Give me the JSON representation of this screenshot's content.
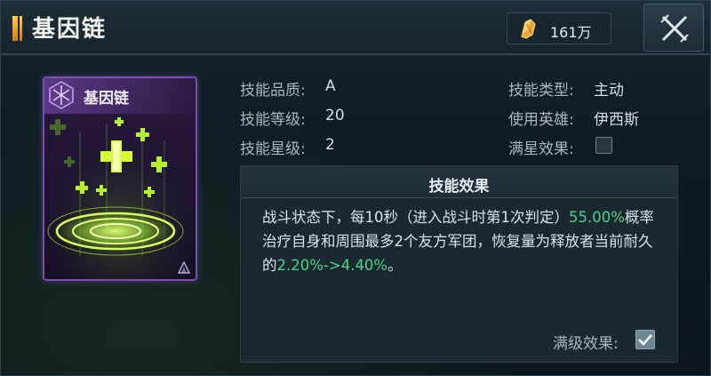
{
  "header": {
    "title": "基因链",
    "currency_amount": "161万",
    "icons": {
      "currency": "gold-crystal-icon",
      "close": "close-x-icon"
    }
  },
  "card": {
    "name": "基因链",
    "icons": {
      "badge": "hexagon-emblem-icon",
      "corner": "rank-mark-icon"
    }
  },
  "stats": {
    "quality_label": "技能品质:",
    "quality_value": "A",
    "level_label": "技能等级:",
    "level_value": "20",
    "star_label": "技能星级:",
    "star_value": "2",
    "type_label": "技能类型:",
    "type_value": "主动",
    "hero_label": "使用英雄:",
    "hero_value": "伊西斯",
    "max_star_label": "满星效果:",
    "max_star_checked": false
  },
  "effect": {
    "title": "技能效果",
    "text_1": "战斗状态下，每10秒（进入战斗时第1次判定）",
    "highlight_1": "55.00%",
    "text_2": "概率治疗自身和周围最多2个友方军团，恢复量为释放者当前耐久的",
    "highlight_2": "2.20%->4.40%",
    "text_3": "。",
    "max_level_label": "满级效果:",
    "max_level_checked": true
  },
  "colors": {
    "highlight": "#4fd18a",
    "card_border": "#7a4fb0",
    "title_accent": "#ffce4a"
  }
}
